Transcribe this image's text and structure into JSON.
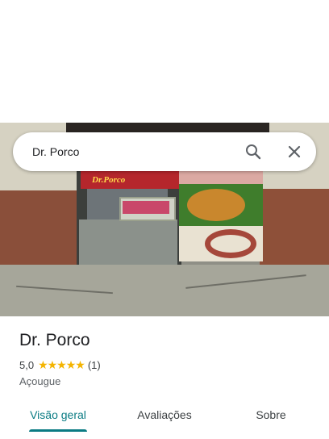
{
  "search": {
    "query": "Dr. Porco",
    "search_icon": "search-icon",
    "close_icon": "close-icon"
  },
  "photo": {
    "storefront_sign": "Dr.Porco"
  },
  "place": {
    "name": "Dr. Porco",
    "rating": "5,0",
    "stars": "★★★★★",
    "rating_value": 5,
    "review_count": "(1)",
    "category": "Açougue"
  },
  "tabs": [
    {
      "label": "Visão geral",
      "active": true
    },
    {
      "label": "Avaliações",
      "active": false
    },
    {
      "label": "Sobre",
      "active": false
    }
  ],
  "colors": {
    "accent": "#0a7b83",
    "star": "#f4b400"
  }
}
